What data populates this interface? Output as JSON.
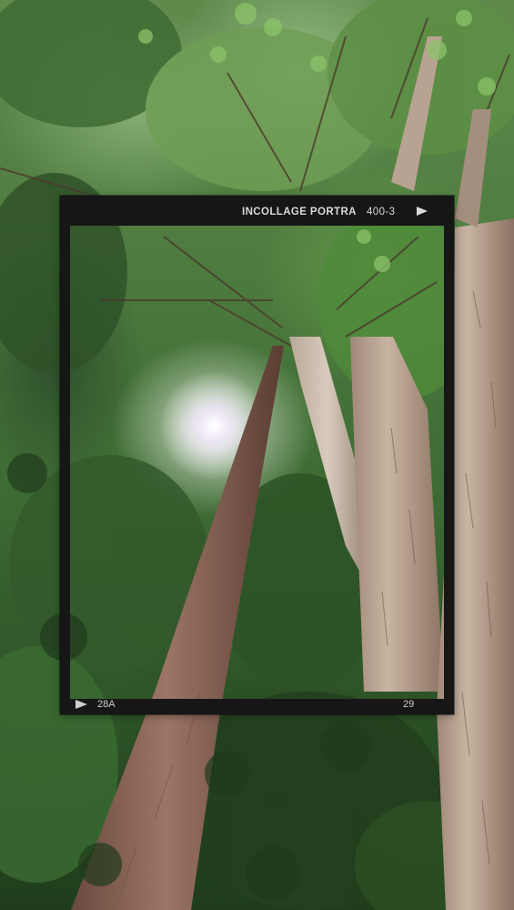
{
  "film": {
    "brand": "INCOLLAGE PORTRA",
    "code": "400-3",
    "frame_left": "28A",
    "frame_right": "29"
  },
  "colors": {
    "frame": "#161616",
    "film_text": "#d9d9d9"
  },
  "icons": {
    "top_arrow": "play-triangle-icon",
    "bottom_arrow": "play-triangle-icon"
  }
}
